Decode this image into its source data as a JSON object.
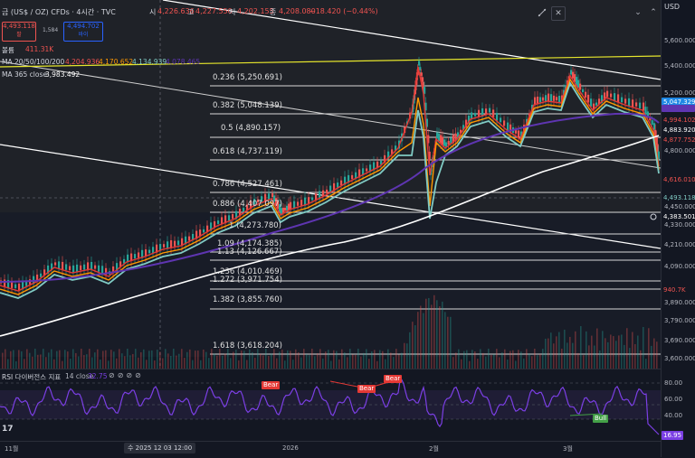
{
  "header": {
    "symbol": "금 (US$ / OZ) CFDs · 4시간 · TVC",
    "open_label": "시",
    "open": "4,226.636",
    "high_label": "고",
    "high": "4,227.550",
    "low_label": "저",
    "low": "4,202.155",
    "close_label": "종",
    "close": "4,208.080",
    "change": "−18.420 (−0.44%)",
    "sell_price": "4,493.118",
    "sell_label": "팔",
    "spread": "1,584",
    "buy_price": "4,494.702",
    "buy_label": "바이",
    "volume_label": "볼륨",
    "volume_value": "411.31K",
    "ma_label": "MA 20/50/100/200",
    "ma20": "4,204.936",
    "ma50": "4,170.652",
    "ma100": "4,134.939",
    "ma200": "4,078.465",
    "ma365_label": "MA 365 close",
    "ma365": "3,983.492",
    "currency": "USD"
  },
  "colors": {
    "ma20": "#e53935",
    "ma50": "#ff9800",
    "ma100": "#80cbc4",
    "ma200": "#5e35b1",
    "ma365": "#ffffff",
    "fib_line": "#d8d8d8",
    "yellow_line": "#e6e62c",
    "rsi": "#7b3fe4",
    "up": "#26a69a",
    "down": "#ef5350"
  },
  "fib_levels": [
    {
      "label": "0.236 (5,250.691)"
    },
    {
      "label": "0.382 (5,048.139)"
    },
    {
      "label": "0.5 (4,890.157)"
    },
    {
      "label": "0.618 (4,737.119)"
    },
    {
      "label": "0.786 (4,527.461)"
    },
    {
      "label": "0.886 (4,407.097)"
    },
    {
      "label": "1 (4,273.780)"
    },
    {
      "label": "1.09 (4,174.385)"
    },
    {
      "label": "1.13 (4,126.667)"
    },
    {
      "label": "1.236 (4,010.469)"
    },
    {
      "label": "1.272 (3,971.754)"
    },
    {
      "label": "1.382 (3,855.760)"
    },
    {
      "label": "1.618 (3,618.204)"
    }
  ],
  "price_ticks": [
    "5,600.000",
    "5,400.000",
    "5,200.000",
    "4,800.000",
    "4,450.000",
    "4,330.000",
    "4,210.000",
    "4,090.000",
    "3,890.000",
    "3,790.000",
    "3,690.000",
    "3,600.000"
  ],
  "price_tags": {
    "t1": "5,047.329",
    "t2": "4,994.102",
    "t3": "4,883.920",
    "t4": "4,877.752",
    "t5": "4,616.010",
    "t6": "4,493.118",
    "t7": "4,383.501",
    "t8": "940.7K",
    "rsi": "16.95"
  },
  "rsi": {
    "label": "RSI 다이버전스 지표",
    "params": "14 close",
    "value": "32.75",
    "ticks": [
      "80.00",
      "60.00",
      "40.00",
      "20.00"
    ],
    "bear": "Bear",
    "bull": "Bull",
    "left_value": "17"
  },
  "time_axis": {
    "labels": [
      "11월",
      "2026",
      "2월",
      "3월"
    ],
    "cursor": "수 2025 12 03   12:00"
  }
}
